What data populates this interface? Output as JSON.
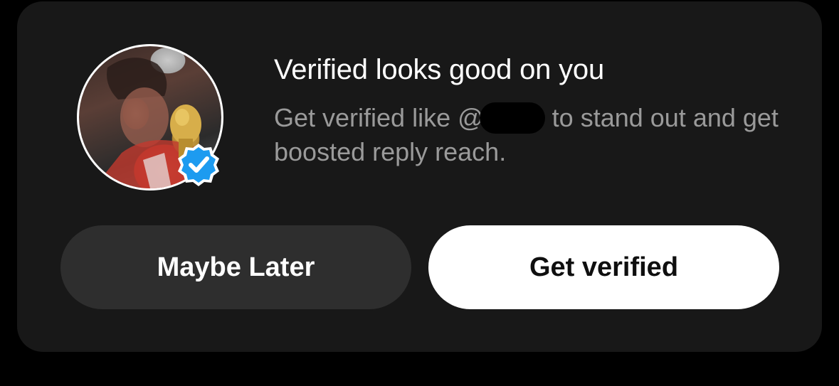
{
  "prompt": {
    "title": "Verified looks good on you",
    "subtitle_before": "Get verified like @",
    "subtitle_after": "to stand out and get boosted reply reach.",
    "badge_color": "#1d9bf0",
    "avatar_icon": "profile-photo",
    "badge_icon": "verified-check-icon"
  },
  "buttons": {
    "secondary_label": "Maybe Later",
    "primary_label": "Get verified"
  }
}
